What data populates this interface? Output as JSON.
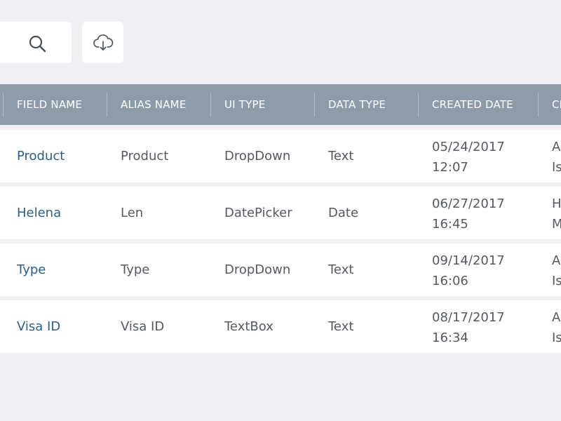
{
  "toolbar": {
    "search_placeholder": "",
    "search_icon": "search-icon",
    "download_icon": "cloud-download-icon"
  },
  "table": {
    "headers": [
      "",
      "FIELD NAME",
      "ALIAS NAME",
      "UI TYPE",
      "DATA TYPE",
      "CREATED DATE",
      "CR"
    ],
    "rows": [
      {
        "field_name": "Product",
        "alias_name": "Product",
        "ui_type": "DropDown",
        "data_type": "Text",
        "created_date": "05/24/2017",
        "created_time": "12:07",
        "created_by_1": "A",
        "created_by_2": "Is"
      },
      {
        "field_name": "Helena",
        "alias_name": "Len",
        "ui_type": "DatePicker",
        "data_type": "Date",
        "created_date": "06/27/2017",
        "created_time": "16:45",
        "created_by_1": "H",
        "created_by_2": "M"
      },
      {
        "field_name": "Type",
        "alias_name": "Type",
        "ui_type": "DropDown",
        "data_type": "Text",
        "created_date": "09/14/2017",
        "created_time": "16:06",
        "created_by_1": "A",
        "created_by_2": "Is"
      },
      {
        "field_name": "Visa ID",
        "alias_name": "Visa ID",
        "ui_type": "TextBox",
        "data_type": "Text",
        "created_date": "08/17/2017",
        "created_time": "16:34",
        "created_by_1": "A",
        "created_by_2": "Is"
      }
    ]
  },
  "colors": {
    "background": "#eef0f3",
    "header_bg": "#8e9ba8",
    "link": "#2b5f86",
    "text": "#555a60"
  }
}
